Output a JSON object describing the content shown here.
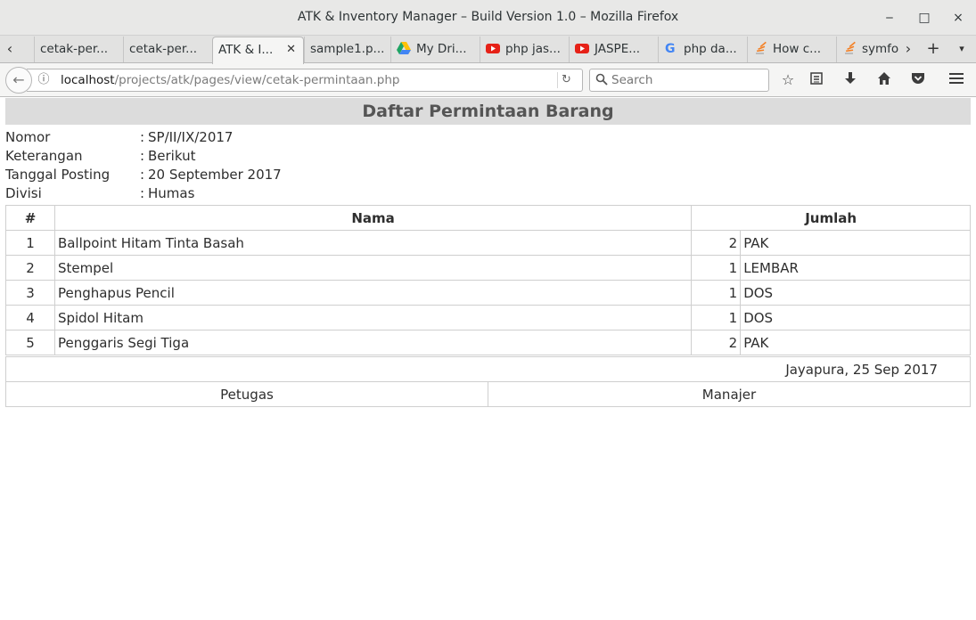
{
  "window": {
    "title": "ATK & Inventory Manager – Build Version 1.0 – Mozilla Firefox",
    "minimize": "‒",
    "maximize": "□",
    "close": "×"
  },
  "tabs": [
    {
      "label": "cetak-per...",
      "icon": "page-icon"
    },
    {
      "label": "cetak-per...",
      "icon": "page-icon"
    },
    {
      "label": "ATK & I...",
      "icon": "page-icon",
      "active": true
    },
    {
      "label": "sample1.p...",
      "icon": "page-icon"
    },
    {
      "label": "My Dri...",
      "icon": "google-drive-icon"
    },
    {
      "label": "php jas...",
      "icon": "youtube-icon"
    },
    {
      "label": "JASPE...",
      "icon": "youtube-icon"
    },
    {
      "label": "php da...",
      "icon": "google-icon"
    },
    {
      "label": "How c...",
      "icon": "stackoverflow-icon"
    },
    {
      "label": "symfo",
      "icon": "stackoverflow-icon"
    }
  ],
  "navbar": {
    "url_host": "localhost",
    "url_path": "/projects/atk/pages/view/cetak-permintaan.php",
    "search_placeholder": "Search"
  },
  "document": {
    "title": "Daftar Permintaan Barang",
    "meta": [
      {
        "key": "Nomor",
        "value": "SP/II/IX/2017"
      },
      {
        "key": "Keterangan",
        "value": "Berikut"
      },
      {
        "key": "Tanggal Posting",
        "value": "20 September 2017"
      },
      {
        "key": "Divisi",
        "value": "Humas"
      }
    ],
    "separator": ":",
    "columns": {
      "no": "#",
      "nama": "Nama",
      "jumlah": "Jumlah"
    },
    "items": [
      {
        "no": "1",
        "nama": "Ballpoint Hitam Tinta Basah",
        "qty": "2",
        "unit": "PAK"
      },
      {
        "no": "2",
        "nama": "Stempel",
        "qty": "1",
        "unit": "LEMBAR"
      },
      {
        "no": "3",
        "nama": "Penghapus Pencil",
        "qty": "1",
        "unit": "DOS"
      },
      {
        "no": "4",
        "nama": "Spidol Hitam",
        "qty": "1",
        "unit": "DOS"
      },
      {
        "no": "5",
        "nama": "Penggaris Segi Tiga",
        "qty": "2",
        "unit": "PAK"
      }
    ],
    "place_date": "Jayapura, 25 Sep 2017",
    "signers": [
      "Petugas",
      "Manajer"
    ]
  },
  "colors": {
    "title_bg": "#dcdcdc",
    "border": "#cfcfcf"
  }
}
